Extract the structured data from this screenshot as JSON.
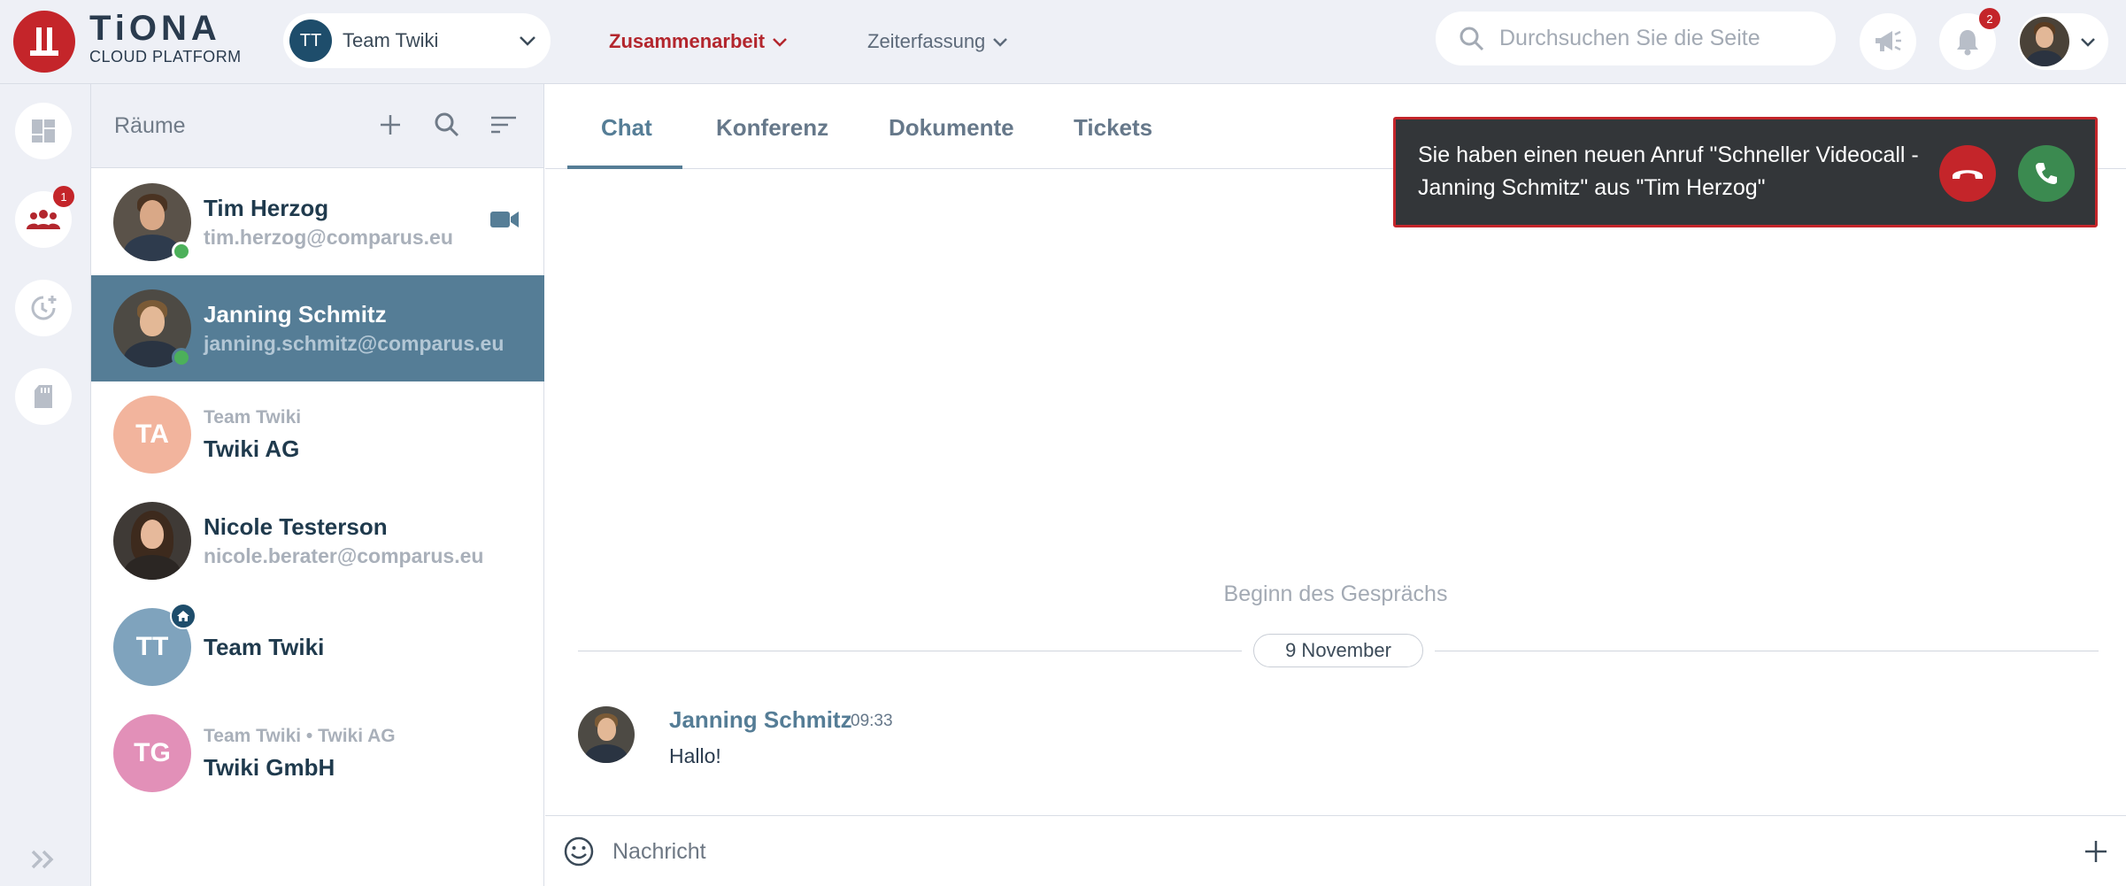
{
  "brand": {
    "title": "TiONA",
    "subtitle": "CLOUD PLATFORM",
    "color": "#c4252a"
  },
  "team_selector": {
    "initials": "TT",
    "label": "Team Twiki"
  },
  "nav": {
    "collaboration": "Zusammenarbeit",
    "time_tracking": "Zeiterfassung"
  },
  "search": {
    "placeholder": "Durchsuchen Sie die Seite"
  },
  "notifications": {
    "count": "2"
  },
  "rail": {
    "rooms_badge": "1"
  },
  "rooms": {
    "title": "Räume",
    "items": [
      {
        "name": "Tim Herzog",
        "sub": "tim.herzog@comparus.eu"
      },
      {
        "name": "Janning Schmitz",
        "sub": "janning.schmitz@comparus.eu"
      },
      {
        "initials": "TA",
        "pre": "Team Twiki",
        "name": "Twiki AG"
      },
      {
        "name": "Nicole Testerson",
        "sub": "nicole.berater@comparus.eu"
      },
      {
        "initials": "TT",
        "name": "Team Twiki"
      },
      {
        "initials": "TG",
        "pre": "Team Twiki • Twiki AG",
        "name": "Twiki GmbH"
      }
    ]
  },
  "tabs": [
    "Chat",
    "Konferenz",
    "Dokumente",
    "Tickets"
  ],
  "chat": {
    "begin_label": "Beginn des Gesprächs",
    "date": "9 November",
    "message": {
      "sender": "Janning Schmitz",
      "time": "09:33",
      "text": "Hallo!"
    },
    "composer_placeholder": "Nachricht"
  },
  "call_notification": {
    "text": "Sie haben einen neuen Anruf \"Schneller Videocall - Janning Schmitz\" aus \"Tim Herzog\""
  }
}
